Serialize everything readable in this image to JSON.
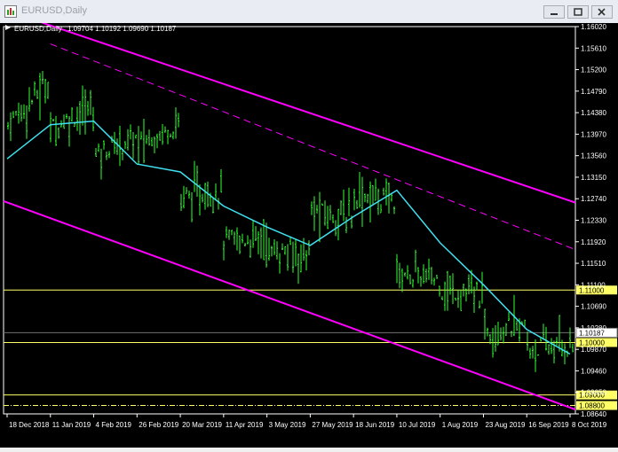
{
  "window": {
    "title": "EURUSD,Daily"
  },
  "chart_info": {
    "symbol": "EURUSD,Daily",
    "ohlc": "1.09704 1.10192 1.09690 1.10187"
  },
  "chart_data": {
    "type": "line",
    "title": "EURUSD,Daily",
    "x_ticks": [
      "18 Dec 2018",
      "11 Jan 2019",
      "4 Feb 2019",
      "26 Feb 2019",
      "20 Mar 2019",
      "11 Apr 2019",
      "3 May 2019",
      "27 May 2019",
      "18 Jun 2019",
      "10 Jul 2019",
      "1 Aug 2019",
      "23 Aug 2019",
      "16 Sep 2019",
      "8 Oct 2019"
    ],
    "y_ticks": [
      "1.16020",
      "1.15610",
      "1.15200",
      "1.14790",
      "1.14380",
      "1.13970",
      "1.13560",
      "1.13150",
      "1.12740",
      "1.12330",
      "1.11920",
      "1.11510",
      "1.11100",
      "1.10690",
      "1.10280",
      "1.09870",
      "1.09460",
      "1.09050",
      "1.08640"
    ],
    "ylim": [
      1.0864,
      1.1602
    ],
    "price_labels": [
      "1.11000",
      "1.10187",
      "1.10000",
      "1.09000",
      "1.08800"
    ],
    "horizontal_levels": [
      {
        "value": 1.11,
        "label": "1.11000",
        "style": "solid",
        "color": "#ffff66"
      },
      {
        "value": 1.1,
        "label": "1.10000",
        "style": "solid",
        "color": "#ffff66"
      },
      {
        "value": 1.09,
        "label": "1.09000",
        "style": "solid",
        "color": "#ffff66"
      },
      {
        "value": 1.088,
        "label": "1.08800",
        "style": "dashdot",
        "color": "#ffff66"
      }
    ],
    "current_price": {
      "value": 1.10187,
      "label": "1.10187",
      "color": "#c0c0c0"
    },
    "channel_lines": [
      {
        "name": "upper",
        "from": [
          "18 Dec 2018",
          1.1632
        ],
        "to": [
          "8 Oct 2019",
          1.127
        ],
        "style": "solid",
        "color": "#ff00ff"
      },
      {
        "name": "middle",
        "from": [
          "11 Jan 2019",
          1.1569
        ],
        "to": [
          "8 Oct 2019",
          1.1181
        ],
        "style": "dashed",
        "color": "#ff00ff"
      },
      {
        "name": "lower",
        "from": [
          "18 Dec 2018",
          1.1267
        ],
        "to": [
          "8 Oct 2019",
          1.0876
        ],
        "style": "solid",
        "color": "#ff00ff"
      }
    ],
    "moving_average": {
      "color": "#40e0f0",
      "points": [
        [
          "18 Dec 2018",
          1.135
        ],
        [
          "28 Dec 2018",
          1.1365
        ],
        [
          "11 Jan 2019",
          1.1415
        ],
        [
          "22 Jan 2019",
          1.1408
        ],
        [
          "4 Feb 2019",
          1.1422
        ],
        [
          "14 Feb 2019",
          1.137
        ],
        [
          "26 Feb 2019",
          1.134
        ],
        [
          "8 Mar 2019",
          1.1318
        ],
        [
          "20 Mar 2019",
          1.1325
        ],
        [
          "1 Apr 2019",
          1.1285
        ],
        [
          "11 Apr 2019",
          1.126
        ],
        [
          "23 Apr 2019",
          1.1235
        ],
        [
          "3 May 2019",
          1.122
        ],
        [
          "15 May 2019",
          1.119
        ],
        [
          "27 May 2019",
          1.1185
        ],
        [
          "6 Jun 2019",
          1.12
        ],
        [
          "18 Jun 2019",
          1.124
        ],
        [
          "28 Jun 2019",
          1.13
        ],
        [
          "10 Jul 2019",
          1.129
        ],
        [
          "20 Jul 2019",
          1.1275
        ],
        [
          "1 Aug 2019",
          1.119
        ],
        [
          "12 Aug 2019",
          1.116
        ],
        [
          "23 Aug 2019",
          1.111
        ],
        [
          "5 Sep 2019",
          1.1055
        ],
        [
          "16 Sep 2019",
          1.1025
        ],
        [
          "27 Sep 2019",
          1.0995
        ],
        [
          "8 Oct 2019",
          1.0978
        ]
      ]
    },
    "price_path": [
      [
        "18 Dec 2018",
        1.138
      ],
      [
        "28 Dec 2018",
        1.14
      ],
      [
        "11 Jan 2019",
        1.15
      ],
      [
        "22 Jan 2019",
        1.136
      ],
      [
        "4 Feb 2019",
        1.145
      ],
      [
        "14 Feb 2019",
        1.129
      ],
      [
        "26 Feb 2019",
        1.139
      ],
      [
        "8 Mar 2019",
        1.124
      ],
      [
        "20 Mar 2019",
        1.142
      ],
      [
        "1 Apr 2019",
        1.123
      ],
      [
        "11 Apr 2019",
        1.129
      ],
      [
        "23 Apr 2019",
        1.115
      ],
      [
        "3 May 2019",
        1.12
      ],
      [
        "15 May 2019",
        1.118
      ],
      [
        "27 May 2019",
        1.117
      ],
      [
        "6 Jun 2019",
        1.13
      ],
      [
        "18 Jun 2019",
        1.124
      ],
      [
        "28 Jun 2019",
        1.139
      ],
      [
        "10 Jul 2019",
        1.127
      ],
      [
        "20 Jul 2019",
        1.125
      ],
      [
        "1 Aug 2019",
        1.112
      ],
      [
        "12 Aug 2019",
        1.12
      ],
      [
        "23 Aug 2019",
        1.109
      ],
      [
        "5 Sep 2019",
        1.1
      ],
      [
        "16 Sep 2019",
        1.103
      ],
      [
        "27 Sep 2019",
        1.09
      ],
      [
        "8 Oct 2019",
        1.0995
      ]
    ]
  }
}
